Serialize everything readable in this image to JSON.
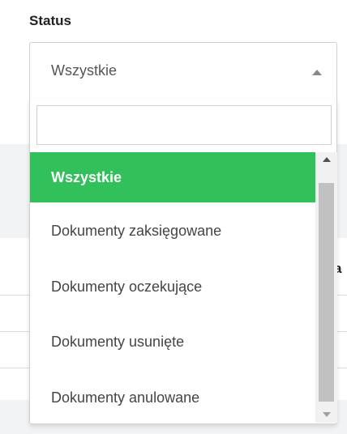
{
  "filter": {
    "label": "Status",
    "selected_value": "Wszystkie",
    "search_value": "",
    "options": [
      {
        "label": "Wszystkie",
        "active": true
      },
      {
        "label": "Dokumenty zaksięgowane",
        "active": false
      },
      {
        "label": "Dokumenty oczekujące",
        "active": false
      },
      {
        "label": "Dokumenty usunięte",
        "active": false
      },
      {
        "label": "Dokumenty anulowane",
        "active": false
      }
    ],
    "accent_color": "#32c05b"
  },
  "background": {
    "peek_text": "a"
  },
  "icons": {
    "caret": "caret-up-icon",
    "scroll_up": "scroll-up-arrow-icon",
    "scroll_down": "scroll-down-arrow-icon"
  }
}
